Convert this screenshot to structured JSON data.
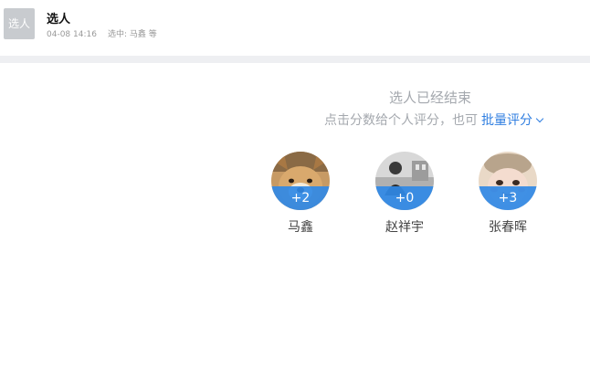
{
  "header": {
    "icon_text": "选人",
    "title": "选人",
    "time": "04-08 14:16",
    "selected": "选中: 马鑫 等"
  },
  "status": {
    "message": "选人已经结束",
    "hint": "点击分数给个人评分，也可",
    "batch_label": "批量评分"
  },
  "people": [
    {
      "name": "马鑫",
      "score": "+2",
      "avatar": "dog-photo"
    },
    {
      "name": "赵祥宇",
      "score": "+0",
      "avatar": "person-bw-photo"
    },
    {
      "name": "张春晖",
      "score": "+3",
      "avatar": "cartoon-photo"
    }
  ],
  "colors": {
    "accent": "#2f7ee0",
    "score_band": "#3089e6",
    "muted_text": "#a4a8ae",
    "divider": "#eeeff2"
  }
}
